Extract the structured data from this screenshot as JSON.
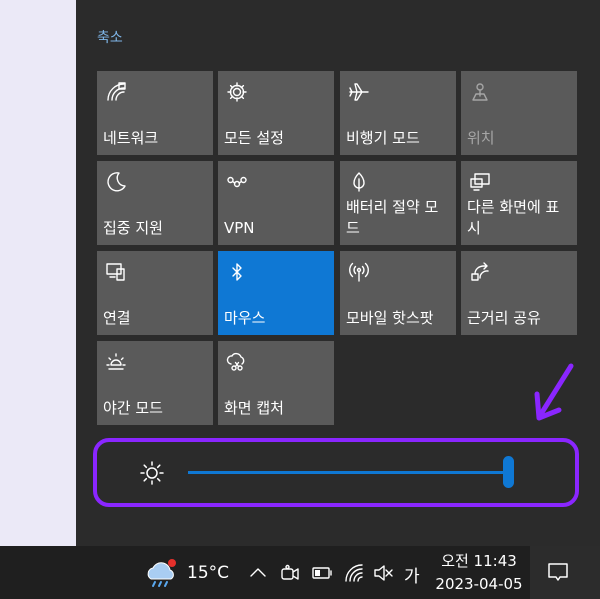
{
  "action_center": {
    "collapse_label": "축소",
    "tiles": [
      {
        "label": "네트워크",
        "icon": "network-icon",
        "state": "off"
      },
      {
        "label": "모든 설정",
        "icon": "gear-icon",
        "state": "off"
      },
      {
        "label": "비행기 모드",
        "icon": "airplane-icon",
        "state": "off"
      },
      {
        "label": "위치",
        "icon": "location-icon",
        "state": "disabled"
      },
      {
        "label": "집중 지원",
        "icon": "moon-icon",
        "state": "off"
      },
      {
        "label": "VPN",
        "icon": "vpn-icon",
        "state": "off"
      },
      {
        "label": "배터리 절약 모드",
        "icon": "battery-saver-icon",
        "state": "off"
      },
      {
        "label": "다른 화면에 표시",
        "icon": "project-icon",
        "state": "off"
      },
      {
        "label": "연결",
        "icon": "connect-icon",
        "state": "off"
      },
      {
        "label": "마우스",
        "icon": "bluetooth-icon",
        "state": "on"
      },
      {
        "label": "모바일 핫스팟",
        "icon": "hotspot-icon",
        "state": "off"
      },
      {
        "label": "근거리 공유",
        "icon": "nearby-share-icon",
        "state": "off"
      },
      {
        "label": "야간 모드",
        "icon": "night-light-icon",
        "state": "off"
      },
      {
        "label": "화면 캡처",
        "icon": "screen-snip-icon",
        "state": "off"
      }
    ],
    "brightness": {
      "icon": "brightness-icon",
      "value_percent": 100
    }
  },
  "annotation": {
    "color": "#8a26ff"
  },
  "taskbar": {
    "weather_icon": "weather-icon",
    "temperature": "15°C",
    "tray_icons": [
      "chevron-up-icon",
      "meet-now-icon",
      "battery-icon",
      "wifi-icon",
      "volume-muted-icon"
    ],
    "ime_label": "가",
    "time": "오전 11:43",
    "date": "2023-04-05",
    "notification_icon": "notification-icon"
  },
  "colors": {
    "accent": "#0f78d4",
    "tile": "#5a5a5a",
    "panel": "#2b2b2b",
    "taskbar": "#1f1f1f",
    "collapse_link": "#7fb6e8"
  }
}
